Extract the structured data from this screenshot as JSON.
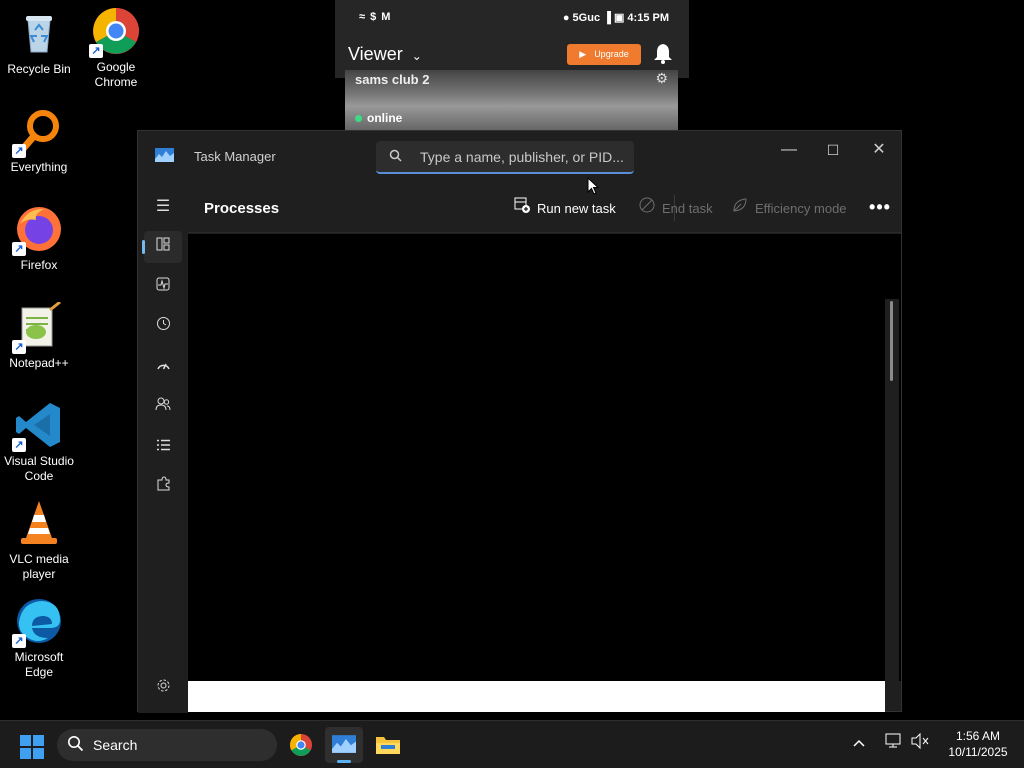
{
  "desktop": {
    "icons": [
      {
        "label": "Recycle Bin"
      },
      {
        "label": "Google Chrome"
      },
      {
        "label": "Everything"
      },
      {
        "label": "Firefox"
      },
      {
        "label": "Notepad++"
      },
      {
        "label": "Visual Studio Code"
      },
      {
        "label": "VLC media player"
      },
      {
        "label": "Microsoft Edge"
      }
    ]
  },
  "phone": {
    "status_left": "≈ $ M",
    "status_right": "● 5Guc ▐ ▣ 4:15 PM",
    "viewer_title": "Viewer",
    "upgrade_label": "Upgrade",
    "camera_title": "sams club 2",
    "camera_status": "online"
  },
  "task_manager": {
    "title": "Task Manager",
    "search_placeholder": "Type a name, publisher, or PID...",
    "page_title": "Processes",
    "toolbar": {
      "run_new_task": "Run new task",
      "end_task": "End task",
      "efficiency_mode": "Efficiency mode",
      "more": "•••"
    },
    "window_controls": {
      "minimize": "—",
      "maximize": "☐",
      "close": "✕"
    }
  },
  "taskbar": {
    "search_label": "Search",
    "time": "1:56 AM",
    "date": "10/11/2025"
  },
  "colors": {
    "accent": "#76b9ed",
    "upgrade": "#f07b2e",
    "online": "#3ddc84"
  }
}
